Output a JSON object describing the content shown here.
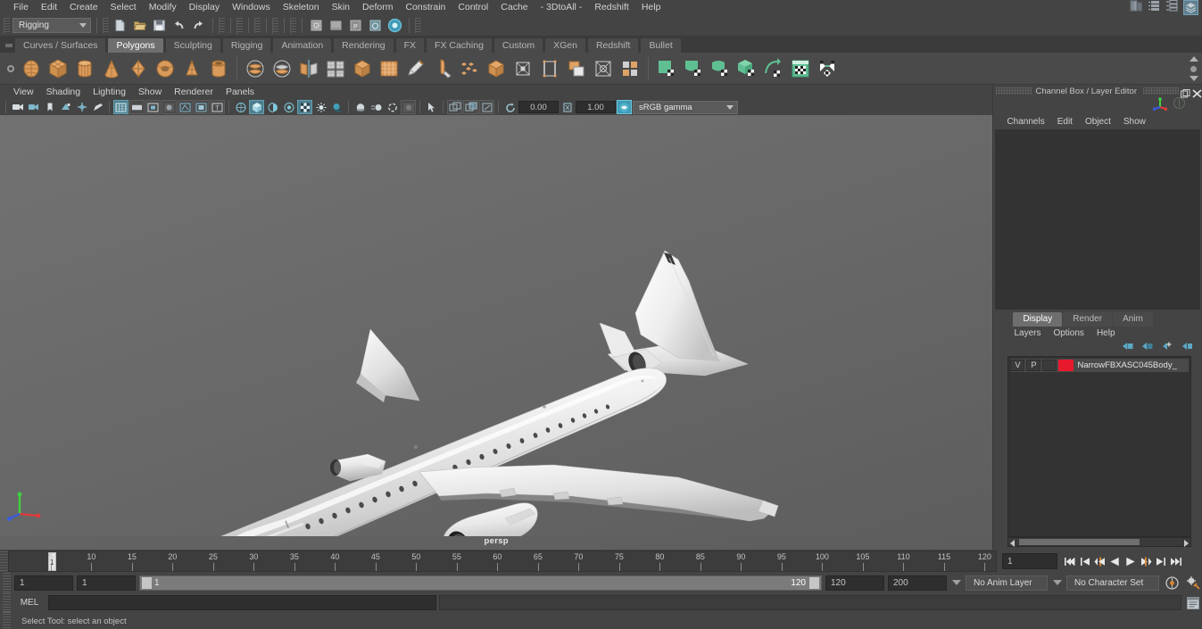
{
  "app": {
    "menus": [
      "File",
      "Edit",
      "Create",
      "Select",
      "Modify",
      "Display",
      "Windows",
      "Skeleton",
      "Skin",
      "Deform",
      "Constrain",
      "Control",
      "Cache",
      "- 3DtoAll -",
      "Redshift",
      "Help"
    ]
  },
  "status_line": {
    "menu_set": "Rigging",
    "icons": [
      "new-scene-icon",
      "open-scene-icon",
      "save-scene-icon",
      "undo-icon",
      "redo-icon",
      "select-by-hierarchy-icon",
      "select-by-object-icon",
      "select-by-component-icon",
      "highlight-icon",
      "snap-grid-icon",
      "snap-curve-icon",
      "snap-point-icon",
      "snap-view-plane-icon",
      "make-live-icon"
    ]
  },
  "shelf": {
    "tabs": [
      "Curves / Surfaces",
      "Polygons",
      "Sculpting",
      "Rigging",
      "Animation",
      "Rendering",
      "FX",
      "FX Caching",
      "Custom",
      "XGen",
      "Redshift",
      "Bullet"
    ],
    "active_tab": "Polygons",
    "primitive_icons": [
      "poly-sphere-icon",
      "poly-cube-icon",
      "poly-cylinder-icon",
      "poly-cone-icon",
      "poly-plane-icon",
      "poly-torus-icon",
      "poly-prism-icon",
      "poly-pipe-icon"
    ],
    "op_icons": [
      "poly-boolean-union-icon",
      "poly-boolean-difference-icon",
      "poly-mirror-icon",
      "poly-smooth-icon",
      "poly-reduce-icon",
      "poly-remesh-icon",
      "poly-multi-cut-icon",
      "poly-sculpt-icon",
      "poly-target-weld-icon",
      "poly-combine-icon",
      "poly-bevel-icon",
      "poly-bridge-icon",
      "poly-extrude-icon",
      "poly-fill-hole-icon",
      "poly-quad-draw-icon"
    ],
    "uv_icons": [
      "uv-planar-icon",
      "uv-cylindrical-icon",
      "uv-spherical-icon",
      "uv-automatic-icon",
      "uv-cut-icon",
      "uv-editor-icon",
      "uv-unfold-icon"
    ]
  },
  "viewport": {
    "menus": [
      "View",
      "Shading",
      "Lighting",
      "Show",
      "Renderer",
      "Panels"
    ],
    "camera_label": "persp",
    "exposure_value": "0.00",
    "gamma_value": "1.00",
    "color_profile": "sRGB gamma",
    "axis_gizmo": "axis-gizmo-icon",
    "model": "narrow-body-airliner-3d-model"
  },
  "channel_box": {
    "title": "Channel Box / Layer Editor",
    "menus": [
      "Channels",
      "Edit",
      "Object",
      "Show"
    ]
  },
  "layer_editor": {
    "tabs": [
      "Display",
      "Render",
      "Anim"
    ],
    "active_tab": "Display",
    "menus": [
      "Layers",
      "Options",
      "Help"
    ],
    "columns": [
      "V",
      "P"
    ],
    "layers": [
      {
        "visible": "V",
        "playback": "P",
        "color": "#e8192c",
        "name": "NarrowFBXASC045Body_"
      }
    ]
  },
  "time_slider": {
    "ticks": [
      5,
      10,
      15,
      20,
      25,
      30,
      35,
      40,
      45,
      50,
      55,
      60,
      65,
      70,
      75,
      80,
      85,
      90,
      95,
      100,
      105,
      110,
      115,
      120
    ],
    "start": 1,
    "end": 120,
    "current_frame": "1",
    "frame_field": "1",
    "playback_buttons": [
      "go-to-start-icon",
      "step-back-keyframe-icon",
      "step-back-frame-icon",
      "play-backwards-icon",
      "play-forwards-icon",
      "step-forward-frame-icon",
      "step-forward-keyframe-icon",
      "go-to-end-icon"
    ]
  },
  "range_slider": {
    "anim_start": "1",
    "range_start": "1",
    "range_bar_start": "1",
    "range_bar_end": "120",
    "range_end": "120",
    "anim_end": "200",
    "anim_layer": "No Anim Layer",
    "character_set": "No Character Set",
    "icons": [
      "auto-keyframe-icon",
      "animation-preferences-icon"
    ]
  },
  "command_line": {
    "label": "MEL",
    "input_value": "",
    "output_value": "",
    "script_editor_icon": "script-editor-icon"
  },
  "help_line": {
    "text": "Select Tool: select an object"
  },
  "window_controls": {
    "right_icons": [
      "modeling-toolkit-icon",
      "attribute-editor-icon",
      "channel-box-icon",
      "outliner-icon"
    ]
  },
  "colors": {
    "bg": "#444444",
    "shelf_bg": "#4a4a4a",
    "active_tab": "#6e6e6e",
    "accent_teal": "#4e9fb5",
    "accent_orange": "#d98a45",
    "accent_green": "#5fbf92",
    "layer_red": "#e8192c",
    "viewport_bg": "#666666"
  }
}
